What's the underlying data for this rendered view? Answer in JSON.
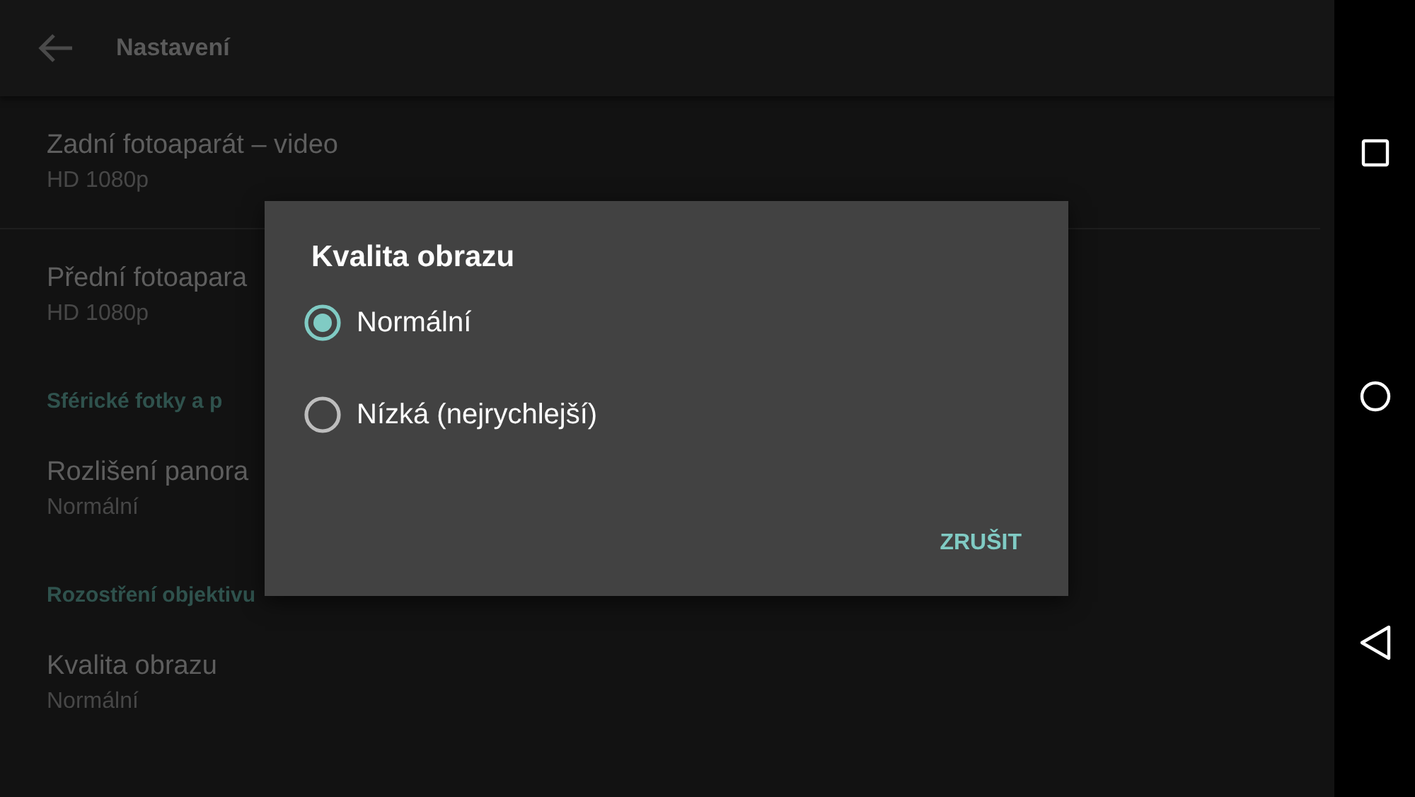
{
  "app_bar": {
    "title": "Nastavení"
  },
  "settings": [
    {
      "kind": "setting",
      "title": "Zadní fotoaparát – video",
      "summary": "HD 1080p",
      "divider": true
    },
    {
      "kind": "setting",
      "title": "Přední fotoapara",
      "summary": "HD 1080p",
      "divider": false
    },
    {
      "kind": "category",
      "title": "Sférické fotky a p"
    },
    {
      "kind": "setting",
      "title": "Rozlišení panora",
      "summary": "Normální",
      "divider": false
    },
    {
      "kind": "category",
      "title": "Rozostření objektivu"
    },
    {
      "kind": "setting",
      "title": "Kvalita obrazu",
      "summary": "Normální",
      "divider": false
    }
  ],
  "dialog": {
    "title": "Kvalita obrazu",
    "options": [
      {
        "label": "Normální",
        "selected": true
      },
      {
        "label": "Nízká (nejrychlejší)",
        "selected": false
      }
    ],
    "buttons": [
      "ZRUŠIT"
    ]
  }
}
